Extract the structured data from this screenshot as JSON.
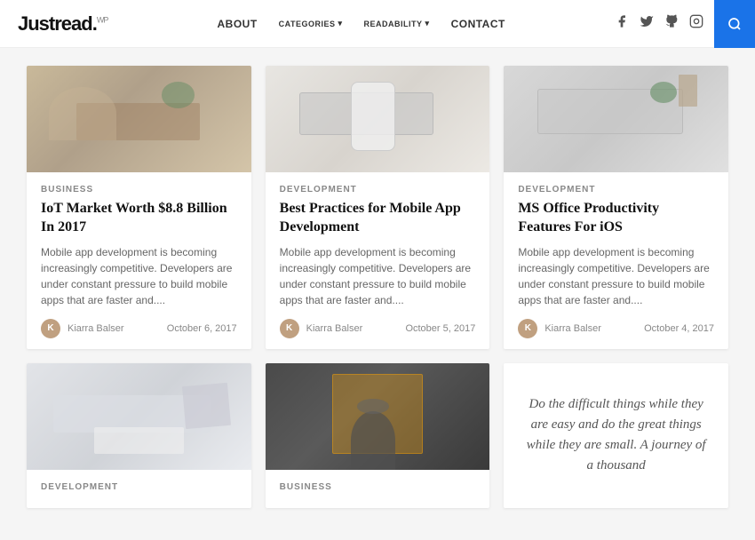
{
  "header": {
    "logo": "Justread.",
    "logo_sup": "WP",
    "nav": [
      {
        "label": "ABOUT",
        "hasDropdown": false
      },
      {
        "label": "CATEGORIES",
        "hasDropdown": true
      },
      {
        "label": "READABILITY",
        "hasDropdown": true
      },
      {
        "label": "CONTACT",
        "hasDropdown": false
      }
    ],
    "search_label": "🔍"
  },
  "cards_row1": [
    {
      "category": "BUSINESS",
      "title": "IoT Market Worth $8.8 Billion In 2017",
      "excerpt": "Mobile app development is becoming increasingly competitive. Developers are under constant pressure to build mobile apps that are faster and....",
      "author": "Kiarra Balser",
      "date": "October 6, 2017",
      "img_class": "card-img-1"
    },
    {
      "category": "DEVELOPMENT",
      "title": "Best Practices for Mobile App Development",
      "excerpt": "Mobile app development is becoming increasingly competitive. Developers are under constant pressure to build mobile apps that are faster and....",
      "author": "Kiarra Balser",
      "date": "October 5, 2017",
      "img_class": "card-img-2"
    },
    {
      "category": "DEVELOPMENT",
      "title": "MS Office Productivity Features For iOS",
      "excerpt": "Mobile app development is becoming increasingly competitive. Developers are under constant pressure to build mobile apps that are faster and....",
      "author": "Kiarra Balser",
      "date": "October 4, 2017",
      "img_class": "card-img-3"
    }
  ],
  "cards_row2": [
    {
      "category": "DEVELOPMENT",
      "title": "",
      "excerpt": "",
      "author": "",
      "date": "",
      "img_class": "card-img-4"
    },
    {
      "category": "BUSINESS",
      "title": "",
      "excerpt": "",
      "author": "",
      "date": "",
      "img_class": "card-img-5"
    }
  ],
  "quote": {
    "text": "Do the difficult things while they are easy and do the great things while they are small. A journey of a thousand"
  },
  "icons": {
    "facebook": "f",
    "twitter": "t",
    "github": "g",
    "instagram": "i",
    "search": "🔍"
  }
}
